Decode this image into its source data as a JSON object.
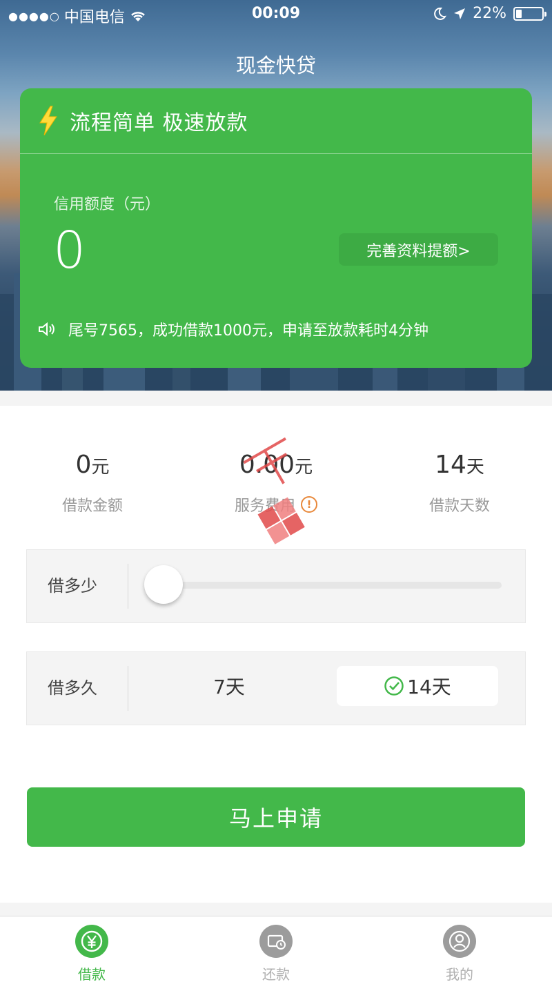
{
  "status_bar": {
    "signal": "●●●●○",
    "carrier": "中国电信",
    "time": "00:09",
    "battery_percent_text": "22%",
    "battery_level": 0.22
  },
  "nav": {
    "title": "现金快贷"
  },
  "card": {
    "slogan": "流程简单 极速放款",
    "credit_label": "信用额度（元）",
    "credit_value": "0",
    "raise_button": "完善资料提额>",
    "notice": "尾号7565，成功借款1000元，申请至放款耗时4分钟"
  },
  "stats": {
    "amount": {
      "value": "0",
      "unit": "元",
      "label": "借款金额"
    },
    "fee": {
      "value": "0.00",
      "unit": "元",
      "label": "服务费用",
      "info_icon": "!"
    },
    "days": {
      "value": "14",
      "unit": "天",
      "label": "借款天数"
    }
  },
  "amount_row": {
    "label": "借多少",
    "slider_fraction": 0
  },
  "term_row": {
    "label": "借多久",
    "options": [
      {
        "label": "7天",
        "selected": false
      },
      {
        "label": "14天",
        "selected": true
      }
    ]
  },
  "apply_button": "马上申请",
  "tabbar": {
    "items": [
      {
        "label": "借款",
        "icon": "yuan-icon",
        "active": true
      },
      {
        "label": "还款",
        "icon": "card-clock-icon",
        "active": false
      },
      {
        "label": "我的",
        "icon": "user-icon",
        "active": false
      }
    ]
  },
  "colors": {
    "accent": "#43b84a",
    "warn": "#e8883a"
  }
}
